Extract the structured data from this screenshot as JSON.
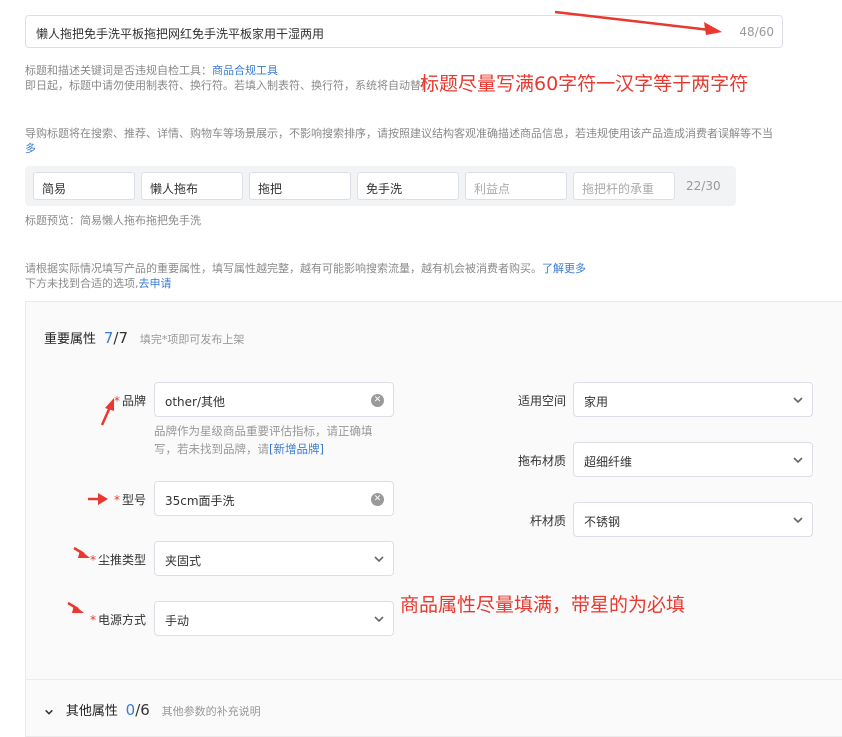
{
  "title_field": {
    "value": "懒人拖把免手洗平板拖把网红免手洗平板家用干湿两用",
    "counter": "48/60"
  },
  "hint1": {
    "text": "标题和描述关键词是否违规自检工具：",
    "link": "商品合规工具"
  },
  "hint2": "即日起，标题中请勿使用制表符、换行符。若填入制表符、换行符，系统将自动替换成空格",
  "note_title": "标题尽量写满60字符一汉字等于两字符",
  "hint3": {
    "text": "导购标题将在搜索、推荐、详情、购物车等场景展示，不影响搜索排序，请按照建议结构客观准确描述商品信息，若违规使用该产品造成消费者误解等不当",
    "more": "多"
  },
  "keywords": [
    {
      "text": "简易",
      "placeholder": false
    },
    {
      "text": "懒人拖布",
      "placeholder": false
    },
    {
      "text": "拖把",
      "placeholder": false
    },
    {
      "text": "免手洗",
      "placeholder": false
    },
    {
      "text": "利益点",
      "placeholder": true
    },
    {
      "text": "拖把杆的承重",
      "placeholder": true
    }
  ],
  "keywords_counter": "22/30",
  "title_preview": "标题预览：简易懒人拖布拖把免手洗",
  "hint4": {
    "text": "请根据实际情况填写产品的重要属性，填写属性越完整，越有可能影响搜索流量，越有机会被消费者购买。",
    "link": "了解更多"
  },
  "hint5": {
    "text": "下方未找到合适的选项,",
    "link": "去申请"
  },
  "important": {
    "title": "重要属性",
    "done": "7",
    "total": "/7",
    "desc": "填完*项即可发布上架"
  },
  "attrs": {
    "brand": {
      "label": "品牌",
      "value": "other/其他",
      "help1": "品牌作为星级商品重要评估指标，请正确填",
      "help2": "写，若未找到品牌，请",
      "help_link": "[新增品牌]"
    },
    "model": {
      "label": "型号",
      "value": "35cm面手洗"
    },
    "type": {
      "label": "尘推类型",
      "value": "夹固式"
    },
    "power": {
      "label": "电源方式",
      "value": "手动"
    },
    "space": {
      "label": "适用空间",
      "value": "家用"
    },
    "material": {
      "label": "拖布材质",
      "value": "超细纤维"
    },
    "rod": {
      "label": "杆材质",
      "value": "不锈钢"
    }
  },
  "note_attrs": "商品属性尽量填满，带星的为必填",
  "other": {
    "title": "其他属性",
    "done": "0",
    "total": "/6",
    "desc": "其他参数的补充说明"
  },
  "colors": {
    "accent": "#3a7bd5",
    "annotation": "#e8382f"
  }
}
